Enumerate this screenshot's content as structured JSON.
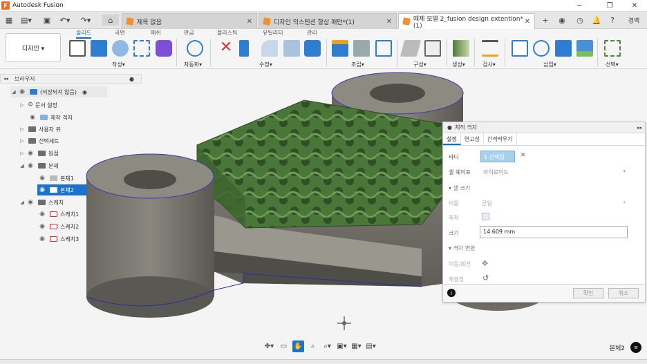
{
  "app": {
    "title": "Autodesk Fusion"
  },
  "tabs": [
    {
      "label": "제목 없음"
    },
    {
      "label": "디자인 익스텐션 향상 패턴*(1)"
    },
    {
      "label": "예제 모델 2_fusion design extention*(1)"
    }
  ],
  "user_initials": "경백",
  "workspace": "디자인 ▾",
  "ribbon_tabs": [
    "솔리드",
    "곡면",
    "메쉬",
    "판금",
    "플라스틱",
    "유틸리티",
    "관리"
  ],
  "groups": [
    "작성▾",
    "자동화▾",
    "수정▾",
    "조립▾",
    "구성▾",
    "생성▾",
    "검사▾",
    "삽입▾",
    "선택▾"
  ],
  "browser": {
    "title": "브라우저",
    "root": "(저장되지 않음)",
    "items": [
      {
        "label": "문서 설정"
      },
      {
        "label": "제작 격자"
      },
      {
        "label": "사용자 뷰"
      },
      {
        "label": "선택세트"
      },
      {
        "label": "원점"
      },
      {
        "label": "본체"
      },
      {
        "label": "본체1"
      },
      {
        "label": "본체2"
      },
      {
        "label": "스케치"
      },
      {
        "label": "스케치1"
      },
      {
        "label": "스케치2"
      },
      {
        "label": "스케치3"
      }
    ]
  },
  "dialog": {
    "title": "체적 격자",
    "tabs": [
      "설정",
      "연고성",
      "간격띄우기"
    ],
    "body_label": "바디",
    "body_value": "1 선택됨",
    "cell_shape_label": "셀 쉐이프",
    "cell_shape_value": "자이로이드",
    "cell_size_header": "셀 크기",
    "ratio_label": "비율",
    "ratio_value": "균일",
    "axis_label": "축척",
    "size_label": "크기",
    "size_value": "14.609 mm",
    "transform_header": "격자 변환",
    "move_label": "이동/회전",
    "reset_label": "재설정",
    "ok": "확인",
    "cancel": "취소"
  },
  "status": {
    "selected": "본체2"
  },
  "colors": {
    "accent": "#1a73d1",
    "lattice": "#4e7a3c",
    "body": "#7a776f"
  }
}
